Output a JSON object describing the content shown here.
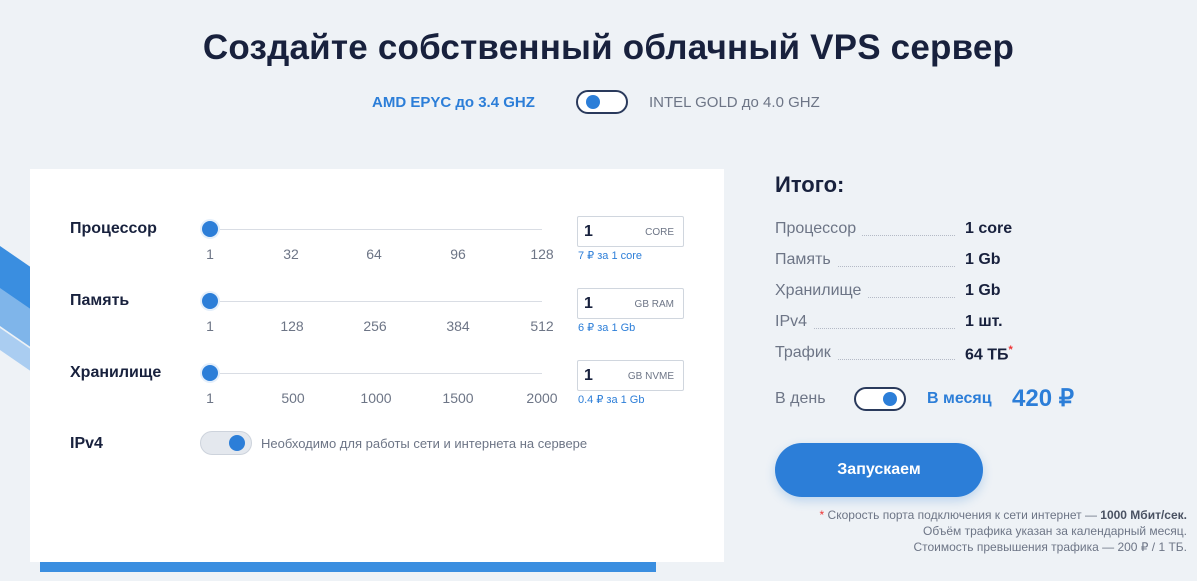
{
  "header": {
    "title": "Создайте собственный облачный VPS сервер"
  },
  "cpu_switch": {
    "left_label": "AMD EPYC до 3.4 GHZ",
    "right_label": "INTEL GOLD до 4.0 GHZ",
    "selected": "AMD EPYC до 3.4 GHZ"
  },
  "config": {
    "processor": {
      "label": "Процессор",
      "ticks": [
        "1",
        "32",
        "64",
        "96",
        "128"
      ],
      "value": "1",
      "unit": "CORE",
      "hint": "7 ₽ за 1 core"
    },
    "memory": {
      "label": "Память",
      "ticks": [
        "1",
        "128",
        "256",
        "384",
        "512"
      ],
      "value": "1",
      "unit": "GB RAM",
      "hint": "6 ₽ за 1 Gb"
    },
    "storage": {
      "label": "Хранилище",
      "ticks": [
        "1",
        "500",
        "1000",
        "1500",
        "2000"
      ],
      "value": "1",
      "unit": "GB NVME",
      "hint": "0.4 ₽ за 1 Gb"
    },
    "ipv4": {
      "label": "IPv4",
      "enabled": true,
      "note": "Необходимо для работы сети и интернета на сервере"
    }
  },
  "summary": {
    "title": "Итого:",
    "rows": [
      {
        "key": "Процессор",
        "value": "1 core"
      },
      {
        "key": "Память",
        "value": "1 Gb"
      },
      {
        "key": "Хранилище",
        "value": "1 Gb"
      },
      {
        "key": "IPv4",
        "value": "1 шт."
      },
      {
        "key": "Трафик",
        "value": "64 ТБ",
        "star": "*"
      }
    ],
    "period_day": "В день",
    "period_month": "В месяц",
    "selected_period": "В месяц",
    "price": "420 ₽",
    "launch_label": "Запускаем"
  },
  "footnote": {
    "star": "*",
    "line1_prefix": " Скорость порта подключения к сети интернет — ",
    "line1_bold": "1000 Мбит/сек.",
    "line2": "Объём трафика указан за календарный месяц.",
    "line3": "Стоимость превышения трафика — 200 ₽ / 1 ТБ."
  },
  "colors": {
    "accent": "#2c7ed8",
    "text": "#18213d",
    "muted": "#6d7586",
    "background": "#eef2f6"
  }
}
